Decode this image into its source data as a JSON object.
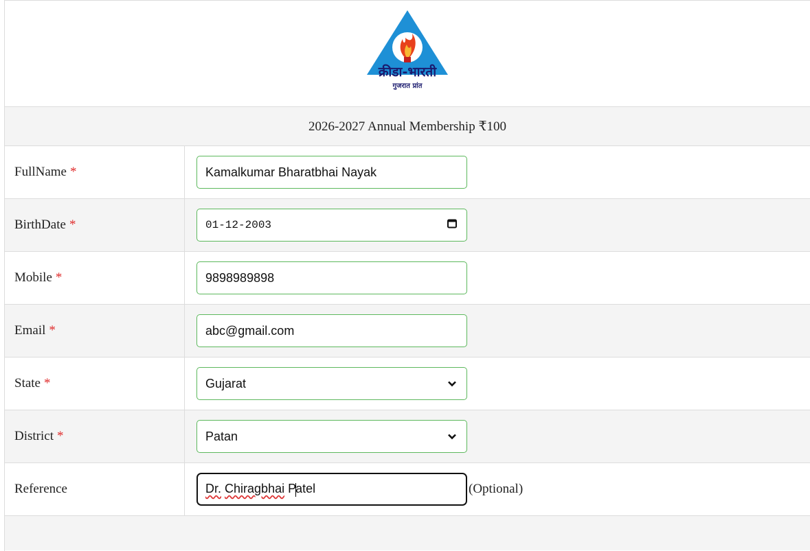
{
  "logo": {
    "main": "क्रीडा-भारती",
    "sub": "गुजरात प्रांत"
  },
  "header": {
    "title": "2026-2027 Annual Membership ₹100"
  },
  "colors": {
    "required": "#e03030",
    "input_border": "#5cb85c",
    "logo_blue": "#1e90d6",
    "flame": "#e8401c"
  },
  "fields": [
    {
      "label": "FullName",
      "required": "*",
      "value": "Kamalkumar Bharatbhai Nayak"
    },
    {
      "label": "BirthDate",
      "required": "*",
      "value": "01-12-2003",
      "icon": "calendar-icon"
    },
    {
      "label": "Mobile",
      "required": "*",
      "value": "9898989898"
    },
    {
      "label": "Email",
      "required": "*",
      "value": "abc@gmail.com"
    },
    {
      "label": "State",
      "required": "*",
      "value": "Gujarat",
      "icon": "chevron-down-icon"
    },
    {
      "label": "District",
      "required": "*",
      "value": "Patan",
      "icon": "chevron-down-icon"
    },
    {
      "label": "Reference",
      "value_part1": "Dr.",
      "value_part2": "Chiragbhai",
      "value_part3": "P",
      "value_part4": "atel",
      "hint": "(Optional)"
    }
  ]
}
